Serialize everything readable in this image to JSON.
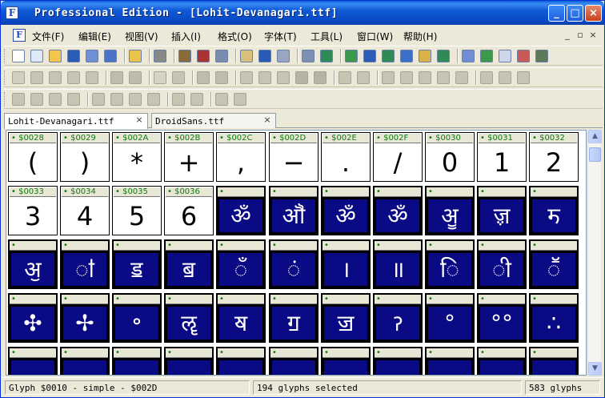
{
  "window": {
    "title": "Professional Edition - [Lohit-Devanagari.ttf]",
    "buttons": {
      "minimize": "_",
      "maximize": "□",
      "close": "×"
    }
  },
  "menu": {
    "items": [
      "文件(F)",
      "编辑(E)",
      "视图(V)",
      "插入(I)",
      "格式(O)",
      "字体(T)",
      "工具(L)",
      "窗口(W)",
      "帮助(H)"
    ],
    "mdi_controls": [
      "_",
      "▫",
      "×"
    ]
  },
  "tabs": [
    {
      "label": "Lohit-Devanagari.ttf",
      "close": "×",
      "active": true
    },
    {
      "label": "DroidSans.ttf",
      "close": "×",
      "active": false
    }
  ],
  "glyph_rows": [
    [
      {
        "label": "$0028",
        "glyph": "(",
        "selected": false
      },
      {
        "label": "$0029",
        "glyph": ")",
        "selected": false
      },
      {
        "label": "$002A",
        "glyph": "*",
        "selected": false
      },
      {
        "label": "$002B",
        "glyph": "+",
        "selected": false
      },
      {
        "label": "$002C",
        "glyph": ",",
        "selected": false
      },
      {
        "label": "$002D",
        "glyph": "−",
        "selected": false
      },
      {
        "label": "$002E",
        "glyph": ".",
        "selected": false
      },
      {
        "label": "$002F",
        "glyph": "/",
        "selected": false
      },
      {
        "label": "$0030",
        "glyph": "0",
        "selected": false
      },
      {
        "label": "$0031",
        "glyph": "1",
        "selected": false
      },
      {
        "label": "$0032",
        "glyph": "2",
        "selected": false
      }
    ],
    [
      {
        "label": "$0033",
        "glyph": "3",
        "selected": false
      },
      {
        "label": "$0034",
        "glyph": "4",
        "selected": false
      },
      {
        "label": "$0035",
        "glyph": "5",
        "selected": false
      },
      {
        "label": "$0036",
        "glyph": "6",
        "selected": false
      },
      {
        "label": "",
        "glyph": "ॐ",
        "selected": true
      },
      {
        "label": "",
        "glyph": "ॵ",
        "selected": true
      },
      {
        "label": "",
        "glyph": "ॐ",
        "selected": true
      },
      {
        "label": "",
        "glyph": "ॐ",
        "selected": true
      },
      {
        "label": "",
        "glyph": "ॷ",
        "selected": true
      },
      {
        "label": "",
        "glyph": "ॹ",
        "selected": true
      },
      {
        "label": "",
        "glyph": "ॸ",
        "selected": true
      }
    ],
    [
      {
        "label": "",
        "glyph": "ॶ",
        "selected": true
      },
      {
        "label": "",
        "glyph": "ऻ",
        "selected": true
      },
      {
        "label": "",
        "glyph": "ॾ",
        "selected": true
      },
      {
        "label": "",
        "glyph": "ॿ",
        "selected": true
      },
      {
        "label": "",
        "glyph": "ँ",
        "selected": true
      },
      {
        "label": "",
        "glyph": "ं",
        "selected": true
      },
      {
        "label": "",
        "glyph": "।",
        "selected": true
      },
      {
        "label": "",
        "glyph": "॥",
        "selected": true
      },
      {
        "label": "",
        "glyph": "ि",
        "selected": true
      },
      {
        "label": "",
        "glyph": "ी",
        "selected": true
      },
      {
        "label": "",
        "glyph": "ॕ",
        "selected": true
      }
    ],
    [
      {
        "label": "",
        "glyph": "✣",
        "selected": true
      },
      {
        "label": "",
        "glyph": "✢",
        "selected": true
      },
      {
        "label": "",
        "glyph": "॰",
        "selected": true
      },
      {
        "label": "",
        "glyph": "ॡ",
        "selected": true
      },
      {
        "label": "",
        "glyph": "ॺ",
        "selected": true
      },
      {
        "label": "",
        "glyph": "ॻ",
        "selected": true
      },
      {
        "label": "",
        "glyph": "ॼ",
        "selected": true
      },
      {
        "label": "",
        "glyph": "ॽ",
        "selected": true
      },
      {
        "label": "",
        "glyph": "°",
        "selected": true
      },
      {
        "label": "",
        "glyph": "°°",
        "selected": true
      },
      {
        "label": "",
        "glyph": "∴",
        "selected": true
      }
    ],
    [
      {
        "label": "",
        "glyph": "",
        "selected": true
      },
      {
        "label": "",
        "glyph": "",
        "selected": true
      },
      {
        "label": "",
        "glyph": "",
        "selected": true
      },
      {
        "label": "",
        "glyph": "",
        "selected": true
      },
      {
        "label": "",
        "glyph": "",
        "selected": true
      },
      {
        "label": "",
        "glyph": "",
        "selected": true
      },
      {
        "label": "",
        "glyph": "",
        "selected": true
      },
      {
        "label": "",
        "glyph": "",
        "selected": true
      },
      {
        "label": "",
        "glyph": "",
        "selected": true
      },
      {
        "label": "",
        "glyph": "",
        "selected": true
      },
      {
        "label": "",
        "glyph": "",
        "selected": true
      }
    ]
  ],
  "status": {
    "glyph_info": "Glyph $0010 - simple - $002D",
    "selection": "194 glyphs selected",
    "total": "583 glyphs"
  },
  "colors": {
    "title_bar": "#0a48c4",
    "selection_fill": "#0a0a84",
    "label_text": "#117a11"
  },
  "icons": {
    "toolbar1": [
      "new-icon",
      "new-list-icon",
      "open-icon",
      "save-icon",
      "save-as-icon",
      "save-all-icon",
      "folder-icon",
      "print-icon",
      "find-icon",
      "cut-icon",
      "copy-icon",
      "paste-icon",
      "undo-icon",
      "redo-icon",
      "refresh-icon",
      "add-glyph-icon",
      "insert-glyph-icon",
      "sort-icon",
      "check-icon",
      "text-icon",
      "tag-icon",
      "validate-icon",
      "grid-icon",
      "add-font-icon",
      "window-icon",
      "eraser-icon",
      "bug-icon"
    ],
    "toolbar2": [
      "select-icon",
      "lasso-icon",
      "hand-icon",
      "measure-icon",
      "pen-icon",
      "zoom-in-icon",
      "zoom-out-icon",
      "frame-icon",
      "crop-icon",
      "arrow-icon",
      "node-icon",
      "image-icon",
      "paint-icon",
      "brush-icon",
      "rect-icon",
      "ellipse-icon",
      "prev-icon",
      "next-icon",
      "grid-4-icon",
      "grid-9-icon",
      "grid-dots-icon",
      "transform-icon",
      "crop-2-icon",
      "slash-icon",
      "nodes-icon",
      "circle-grid-icon"
    ],
    "toolbar3": [
      "align-left-icon",
      "align-center-icon",
      "align-right-icon",
      "align-top-icon",
      "align-middle-icon",
      "align-bottom-icon",
      "distribute-h-icon",
      "distribute-v-icon",
      "space-h-icon",
      "space-v-icon",
      "match-width-icon",
      "match-height-icon"
    ]
  }
}
